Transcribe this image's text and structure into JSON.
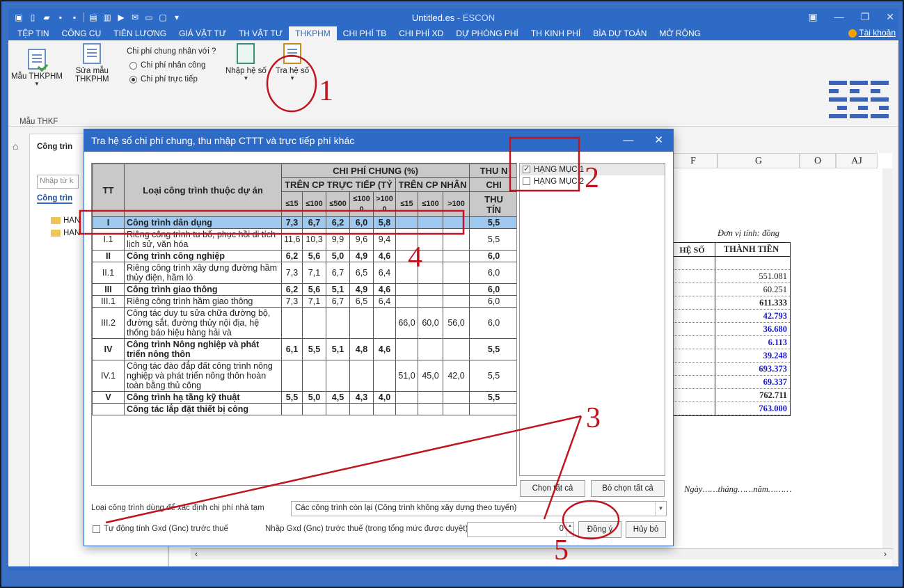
{
  "app": {
    "title_main": "Untitled.es",
    "title_suffix": " - ESCON",
    "account": "Tài khoản",
    "tabs": [
      "TỆP TIN",
      "CÔNG CỤ",
      "TIÊN LƯỢNG",
      "GIÁ VẬT TƯ",
      "TH VẬT TƯ",
      "THKPHM",
      "CHI PHÍ TB",
      "CHI PHÍ XD",
      "DỰ PHÒNG PHÍ",
      "TH KINH PHÍ",
      "BÌA DỰ TOÁN",
      "MỞ RỘNG"
    ],
    "active_tab": "THKPHM"
  },
  "ribbon": {
    "mau_thkphm": "Mẫu THKPHM",
    "sua_mau_1": "Sửa mẫu",
    "sua_mau_2": "THKPHM",
    "radio_title": "Chi phí chung nhân với ?",
    "radio_1": "Chi phí nhân công",
    "radio_2": "Chi phí trực tiếp",
    "radio_selected": "Chi phí trực tiếp",
    "nhap_he_so": "Nhập hệ số",
    "tra_he_so": "Tra hệ số",
    "group_label": "Mẫu THKF"
  },
  "left_panel": {
    "header": "Công trìn",
    "search_placeholder": "Nhập từ k",
    "tab": "Công trìn",
    "items": [
      "HAN",
      "HAN"
    ]
  },
  "sheet": {
    "columns": [
      "F",
      "G",
      "O",
      "AJ"
    ],
    "unit_note": "Đơn vị tính: đồng",
    "col_he_so": "HỆ SỐ",
    "col_thanh_tien": "THÀNH TIỀN",
    "values": [
      {
        "v": "",
        "style": "n"
      },
      {
        "v": "551.081",
        "style": "n"
      },
      {
        "v": "60.251",
        "style": "n"
      },
      {
        "v": "611.333",
        "style": "b"
      },
      {
        "v": "42.793",
        "style": "blue"
      },
      {
        "v": "36.680",
        "style": "blue"
      },
      {
        "v": "6.113",
        "style": "blue"
      },
      {
        "v": "39.248",
        "style": "blue"
      },
      {
        "v": "693.373",
        "style": "blue"
      },
      {
        "v": "69.337",
        "style": "blue"
      },
      {
        "v": "762.711",
        "style": "b"
      },
      {
        "v": "763.000",
        "style": "blue"
      }
    ],
    "date_line": "Ngày……tháng……năm………"
  },
  "dialog": {
    "title": "Tra hệ số chi phí chung, thu nhập CTTT và trực tiếp phí khác",
    "headers": {
      "tt": "TT",
      "loai": "Loại công trình thuộc dự án",
      "chi_phi_chung": "CHI PHÍ CHUNG (%)",
      "tren_cp_tt": "TRÊN CP TRỰC TIẾP (TỶ",
      "tren_cp_nc": "TRÊN CP NHÂN",
      "thu_nhap": "THU N",
      "chi": "CHI",
      "thu": "THU",
      "tinh": "TÍN",
      "sub": [
        "≤15",
        "≤100",
        "≤500",
        "≤100 0",
        ">100 0",
        "≤15",
        "≤100",
        ">100"
      ]
    },
    "rows": [
      {
        "tt": "I",
        "name": "Công trình dân dụng",
        "v": [
          "7,3",
          "6,7",
          "6,2",
          "6,0",
          "5,8",
          "",
          "",
          ""
        ],
        "last": "5,5",
        "bold": true,
        "selected": true
      },
      {
        "tt": "I.1",
        "name": "Riêng công trình tu bổ, phục hồi di tích lịch sử, văn hóa",
        "v": [
          "11,6",
          "10,3",
          "9,9",
          "9,6",
          "9,4",
          "",
          "",
          ""
        ],
        "last": "5,5",
        "bold": false
      },
      {
        "tt": "II",
        "name": "Công trình công nghiệp",
        "v": [
          "6,2",
          "5,6",
          "5,0",
          "4,9",
          "4,6",
          "",
          "",
          ""
        ],
        "last": "6,0",
        "bold": true
      },
      {
        "tt": "II.1",
        "name": "Riêng công trình xây dựng đường hầm thủy điện, hầm lò",
        "v": [
          "7,3",
          "7,1",
          "6,7",
          "6,5",
          "6,4",
          "",
          "",
          ""
        ],
        "last": "6,0",
        "bold": false
      },
      {
        "tt": "III",
        "name": "Công trình giao thông",
        "v": [
          "6,2",
          "5,6",
          "5,1",
          "4,9",
          "4,6",
          "",
          "",
          ""
        ],
        "last": "6,0",
        "bold": true
      },
      {
        "tt": "III.1",
        "name": "Riêng công trình hầm giao thông",
        "v": [
          "7,3",
          "7,1",
          "6,7",
          "6,5",
          "6,4",
          "",
          "",
          ""
        ],
        "last": "6,0",
        "bold": false
      },
      {
        "tt": "III.2",
        "name": "Công tác duy tu sửa chữa đường bộ, đường sắt, đường thủy nội địa, hệ thống báo hiệu hàng hải và",
        "v": [
          "",
          "",
          "",
          "",
          "",
          "66,0",
          "60,0",
          "56,0"
        ],
        "last": "6,0",
        "bold": false
      },
      {
        "tt": "IV",
        "name": "Công trình Nông nghiệp và phát triển nông thôn",
        "v": [
          "6,1",
          "5,5",
          "5,1",
          "4,8",
          "4,6",
          "",
          "",
          ""
        ],
        "last": "5,5",
        "bold": true
      },
      {
        "tt": "IV.1",
        "name": "Công tác đào đắp đất công trình nông nghiệp và phát triển nông thôn hoàn toàn bằng thủ công",
        "v": [
          "",
          "",
          "",
          "",
          "",
          "51,0",
          "45,0",
          "42,0"
        ],
        "last": "5,5",
        "bold": false
      },
      {
        "tt": "V",
        "name": "Công trình hạ tầng kỹ thuật",
        "v": [
          "5,5",
          "5,0",
          "4,5",
          "4,3",
          "4,0",
          "",
          "",
          ""
        ],
        "last": "5,5",
        "bold": true
      },
      {
        "tt": "",
        "name": "Công tác lắp đặt thiết bị công",
        "v": [
          "",
          "",
          "",
          "",
          "",
          "",
          "",
          ""
        ],
        "last": "",
        "bold": true
      }
    ],
    "hang_muc": [
      {
        "label": "HẠNG MỤC 1",
        "checked": true
      },
      {
        "label": "HẠNG MỤC 2",
        "checked": false
      }
    ],
    "btn_select_all": "Chọn tất cả",
    "btn_deselect_all": "Bỏ chọn tất cả",
    "loai_label": "Loại công trình dùng để xác định chi phí nhà tạm",
    "loai_value": "Các công trình còn lại (Công trình không xây dựng theo tuyến)",
    "auto_label": "Tự động tính Gxd (Gnc) trước thuế",
    "nhap_label": "Nhập Gxd (Gnc) trước thuế (trong tổng mức được duyệt)",
    "nhap_value": "0",
    "btn_ok": "Đồng ý",
    "btn_cancel": "Hủy bỏ"
  },
  "annotations": [
    "1",
    "2",
    "3",
    "4",
    "5"
  ],
  "colors": {
    "accent": "#2e6bc6",
    "annotation": "#c0141e",
    "selected_row": "#9fc8ef",
    "blue_value": "#1a1ad0"
  }
}
